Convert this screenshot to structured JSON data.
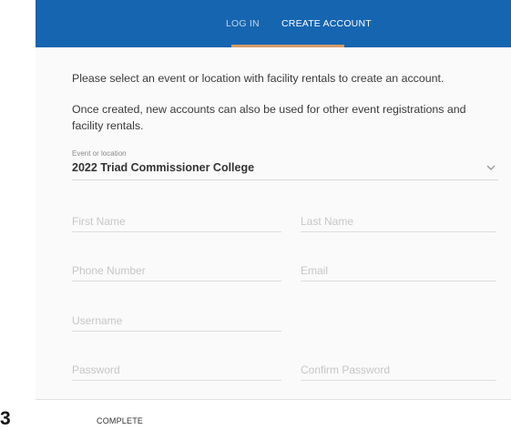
{
  "tabs": {
    "login_label": "LOG IN",
    "create_label": "CREATE ACCOUNT"
  },
  "intro": {
    "line1": "Please select an event or location with facility rentals to create an account.",
    "line2": "Once created, new accounts can also be used for other event registrations and facility rentals."
  },
  "event_select": {
    "label": "Event or location",
    "value": "2022 Triad Commissioner College"
  },
  "fields": {
    "first_name": "First Name",
    "last_name": "Last Name",
    "phone": "Phone Number",
    "email": "Email",
    "username": "Username",
    "password": "Password",
    "confirm_password": "Confirm Password"
  },
  "footer": {
    "step_number": "3",
    "complete_label": "COMPLETE"
  },
  "colors": {
    "header_blue": "#1565b0",
    "tab_underline": "#d79a66"
  }
}
